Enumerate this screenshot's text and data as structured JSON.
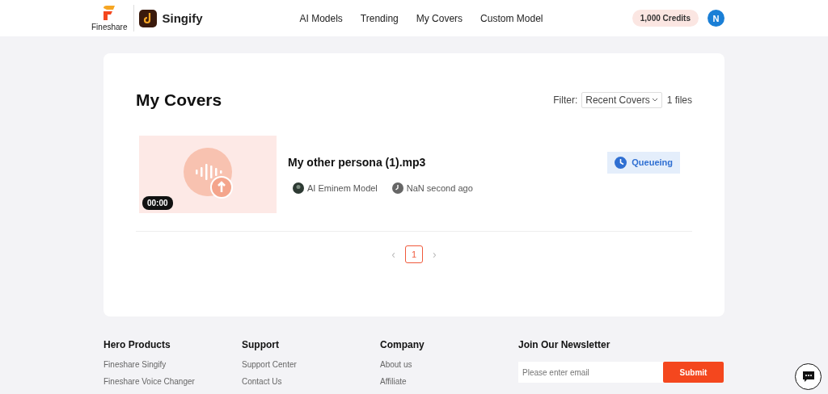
{
  "header": {
    "brand": "Fineshare",
    "app": "Singify",
    "nav": [
      "AI Models",
      "Trending",
      "My Covers",
      "Custom Model"
    ],
    "credits": "1,000 Credits",
    "avatar": "N"
  },
  "page": {
    "title": "My Covers",
    "filter_label": "Filter:",
    "filter_value": "Recent Covers",
    "count": "1 files",
    "covers": [
      {
        "duration": "00:00",
        "name": "My other persona (1).mp3",
        "model": "AI Eminem Model",
        "time": "NaN second ago",
        "status": "Queueing"
      }
    ],
    "pagination": {
      "prev": "‹",
      "next": "›",
      "pages": [
        {
          "label": "1",
          "selected": true
        }
      ]
    }
  },
  "footer": {
    "columns": [
      {
        "title": "Hero Products",
        "links": [
          "Fineshare Singify",
          "Fineshare Voice Changer"
        ]
      },
      {
        "title": "Support",
        "links": [
          "Support Center",
          "Contact Us"
        ]
      },
      {
        "title": "Company",
        "links": [
          "About us",
          "Affiliate"
        ]
      }
    ],
    "newsletter": {
      "title": "Join Our Newsletter",
      "placeholder": "Please enter email",
      "button": "Submit"
    }
  }
}
